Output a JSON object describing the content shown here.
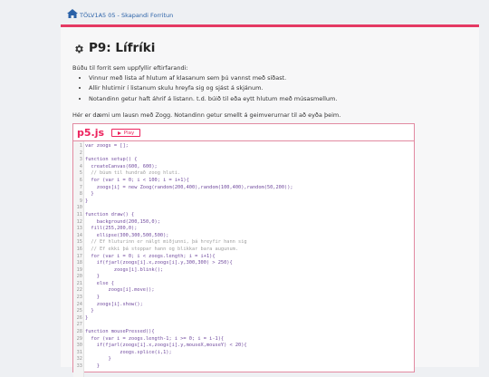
{
  "header": {
    "breadcrumb": "TÖLV1A5 05 - Skapandi Forritun"
  },
  "page": {
    "title": "P9: Lífríki",
    "intro": "Búðu til forrit sem uppfyllir eftirfarandi:",
    "requirements": [
      "Vinnur með lista af hlutum af klasanum sem þú vannst með síðast.",
      "Allir hlutirnir í listanum skulu hreyfa sig og sjást á skjánum.",
      "Notandinn getur haft áhrif á listann. t.d. búið til eða eytt hlutum með músasmellum."
    ],
    "example_text": "Hér er dæmi um lausn með Zogg. Notandinn getur smellt á geimverurnar til að eyða þeim."
  },
  "editor": {
    "logo": "p5.js",
    "play_label": "Play",
    "lines": [
      {
        "n": "1",
        "text": "var zoogs = [];"
      },
      {
        "n": "2",
        "text": ""
      },
      {
        "n": "3",
        "text": "function setup() {"
      },
      {
        "n": "4",
        "text": "  createCanvas(600, 600);"
      },
      {
        "n": "5",
        "text": "  // búum til hundrað zoog hluti."
      },
      {
        "n": "6",
        "text": "  for (var i = 0; i < 100; i = i+1){"
      },
      {
        "n": "7",
        "text": "    zoogs[i] = new Zoog(random(200,400),random(100,400),random(50,200));"
      },
      {
        "n": "8",
        "text": "  }"
      },
      {
        "n": "9",
        "text": "}"
      },
      {
        "n": "10",
        "text": ""
      },
      {
        "n": "11",
        "text": "function draw() {"
      },
      {
        "n": "12",
        "text": "    background(200,150,0);"
      },
      {
        "n": "13",
        "text": "  fill(255,200,0);"
      },
      {
        "n": "14",
        "text": "    ellipse(300,300,500,500);"
      },
      {
        "n": "15",
        "text": "  // Ef hluturinn er nálgt miðjunni, þá hreyfir hann sig"
      },
      {
        "n": "16",
        "text": "  // Ef ekki þá stoppar hann og blikkar bara augunum."
      },
      {
        "n": "17",
        "text": "  for (var i = 0; i < zoogs.length; i = i+1){"
      },
      {
        "n": "18",
        "text": "    if(fjarl(zoogs[i].x,zoogs[i].y,300,300) > 250){"
      },
      {
        "n": "19",
        "text": "          zoogs[i].blink();"
      },
      {
        "n": "20",
        "text": "    }"
      },
      {
        "n": "21",
        "text": "    else {"
      },
      {
        "n": "22",
        "text": "        zoogs[i].move();"
      },
      {
        "n": "23",
        "text": "    }"
      },
      {
        "n": "24",
        "text": "    zoogs[i].show();"
      },
      {
        "n": "25",
        "text": "  }"
      },
      {
        "n": "26",
        "text": "}"
      },
      {
        "n": "27",
        "text": ""
      },
      {
        "n": "28",
        "text": "function mousePressed(){"
      },
      {
        "n": "29",
        "text": "  for (var i = zoogs.length-1; i >= 0; i = i-1){"
      },
      {
        "n": "30",
        "text": "    if(fjarl(zoogs[i].x,zoogs[i].y,mouseX,mouseY) < 20){"
      },
      {
        "n": "31",
        "text": "            zoogs.splice(i,1);"
      },
      {
        "n": "32",
        "text": "        }"
      },
      {
        "n": "33",
        "text": "    }"
      }
    ]
  },
  "colors": {
    "accent": "#e53a63",
    "p5_pink": "#ed225d",
    "link_blue": "#2b62a8",
    "code_purple": "#704a9e",
    "background": "#eef0f3"
  },
  "icons": {
    "home": "home-icon",
    "gear": "gear-icon",
    "play": "play-icon"
  }
}
